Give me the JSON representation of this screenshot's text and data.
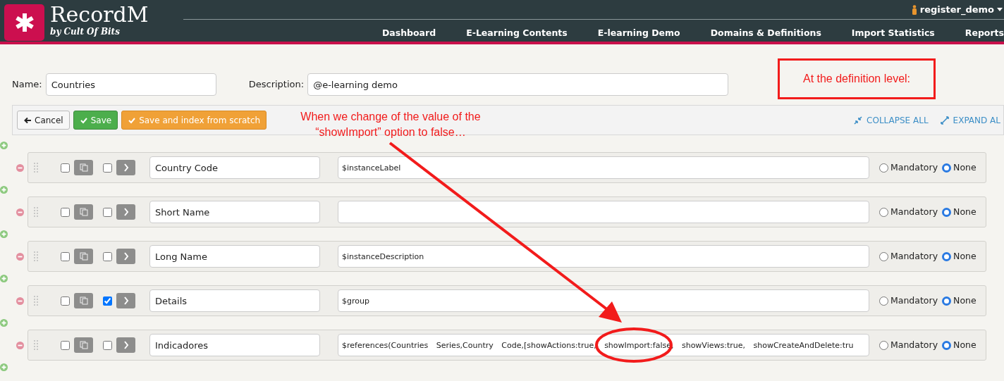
{
  "header": {
    "brand": "RecordM",
    "tagline": "by Cult Of Bits",
    "user": "register_demo",
    "nav": [
      {
        "label": "Dashboard"
      },
      {
        "label": "E-Learning Contents"
      },
      {
        "label": "E-learning Demo"
      },
      {
        "label": "Domains & Definitions"
      },
      {
        "label": "Import Statistics"
      },
      {
        "label": "Reports"
      }
    ]
  },
  "definition": {
    "name_label": "Name:",
    "name": "Countries",
    "description_label": "Description:",
    "description": "@e-learning demo"
  },
  "toolbar": {
    "buttons": [
      {
        "kind": "cancel",
        "label": "Cancel"
      },
      {
        "kind": "save",
        "label": "Save"
      },
      {
        "kind": "reindex",
        "label": "Save and index from scratch"
      }
    ],
    "links": [
      {
        "kind": "collapse",
        "label": "COLLAPSE ALL"
      },
      {
        "kind": "expand",
        "label": "EXPAND AL"
      }
    ]
  },
  "fields": [
    {
      "name": "Country Code",
      "value": "$instanceLabel",
      "selected": false,
      "expanded": false,
      "options": [
        {
          "label": "Mandatory",
          "selected": false
        },
        {
          "label": "None",
          "selected": true
        }
      ]
    },
    {
      "name": "Short Name",
      "selected": false,
      "expanded": false,
      "options": [
        {
          "label": "Mandatory",
          "selected": false
        },
        {
          "label": "None",
          "selected": true
        }
      ]
    },
    {
      "name": "Long Name",
      "value": "$instanceDescription",
      "selected": false,
      "expanded": false,
      "options": [
        {
          "label": "Mandatory",
          "selected": false
        },
        {
          "label": "None",
          "selected": true
        }
      ]
    },
    {
      "name": "Details",
      "value": "$group",
      "selected": false,
      "expanded": true,
      "options": [
        {
          "label": "Mandatory",
          "selected": false
        },
        {
          "label": "None",
          "selected": true
        }
      ]
    },
    {
      "name": "Indicadores",
      "value": "$references(Countries Series,Country Code,[showActions:true, showImport:false, showViews:true, showCreateAndDelete:tru",
      "selected": false,
      "expanded": false,
      "options": [
        {
          "label": "Mandatory",
          "selected": false
        },
        {
          "label": "None",
          "selected": true
        }
      ]
    }
  ],
  "annotations": {
    "note": "At the definition level:",
    "callout": "When we change of the value of the “showImport” option to false…"
  }
}
